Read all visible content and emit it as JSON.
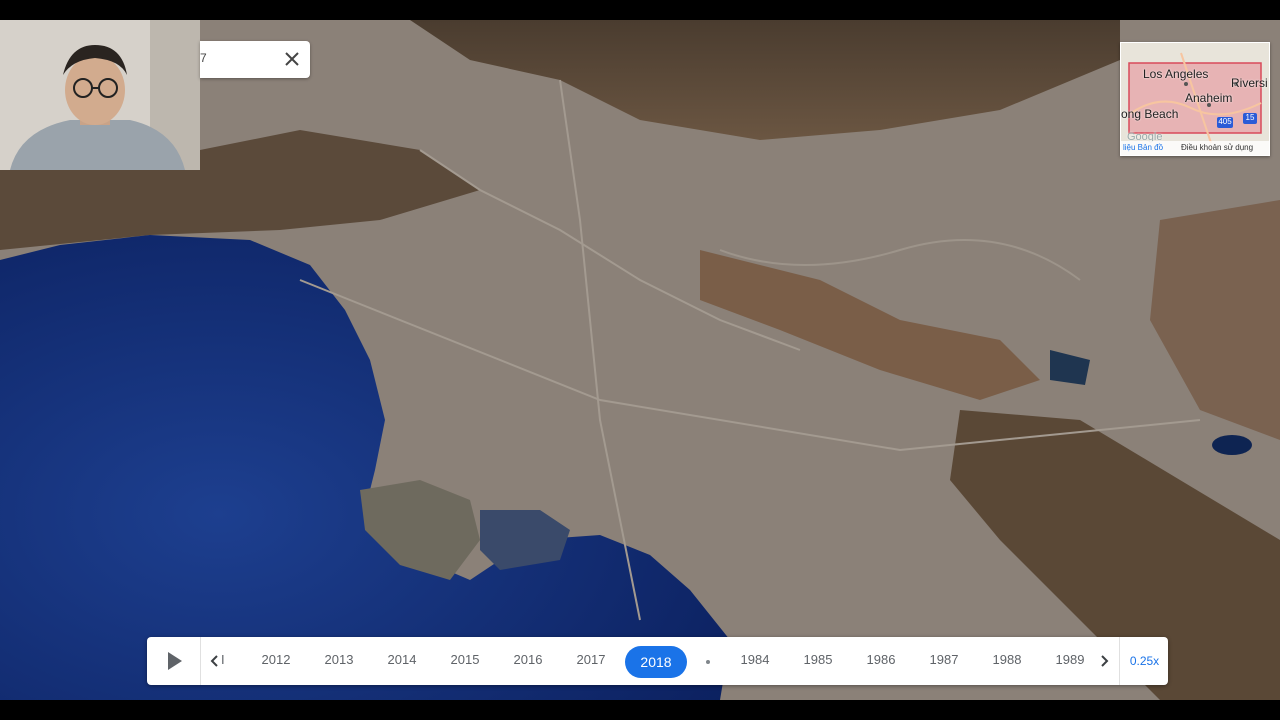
{
  "search": {
    "value": "7"
  },
  "minimap": {
    "labels": {
      "los_angeles": "Los Angeles",
      "riverside": "Riversi",
      "anaheim": "Anaheim",
      "long_beach": "ong Beach",
      "brand": "Google"
    },
    "shields": {
      "i405": "405",
      "i15": "15"
    },
    "footer": {
      "map_data": "liệu Bản đồ",
      "terms": "Điều khoản sử dụng"
    }
  },
  "timeline": {
    "partial_label": "I",
    "years": [
      "2012",
      "2013",
      "2014",
      "2015",
      "2016",
      "2017",
      "2018",
      "1984",
      "1985",
      "1986",
      "1987",
      "1988",
      "1989"
    ],
    "selected_year": "2018",
    "speed": "0.25x"
  },
  "colors": {
    "accent": "#1a73e8",
    "ocean": "#102a6b",
    "land": "#8a7d70"
  }
}
